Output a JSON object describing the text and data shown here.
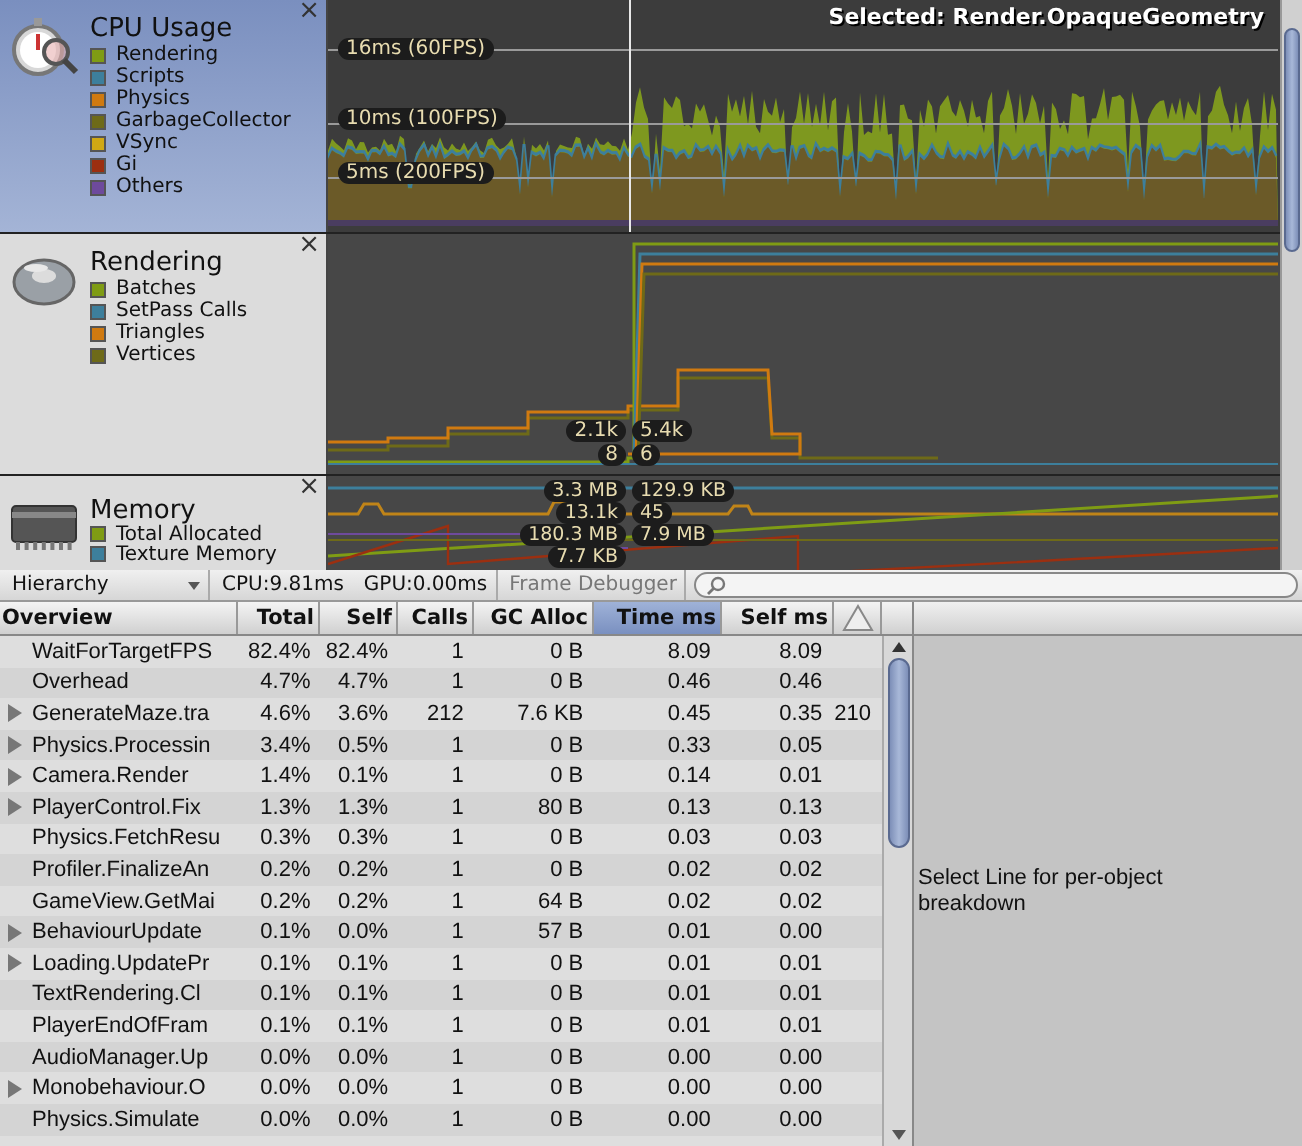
{
  "modules": [
    {
      "kind": "cpu",
      "title": "CPU Usage",
      "selected": true,
      "legend": [
        {
          "label": "Rendering",
          "color": "#7f9c14"
        },
        {
          "label": "Scripts",
          "color": "#3d7f9c"
        },
        {
          "label": "Physics",
          "color": "#d07a10"
        },
        {
          "label": "GarbageCollector",
          "color": "#6e6a18"
        },
        {
          "label": "VSync",
          "color": "#d0a814"
        },
        {
          "label": "Gi",
          "color": "#9c2f10"
        },
        {
          "label": "Others",
          "color": "#6e4a9c"
        }
      ],
      "grid_labels": [
        "16ms (60FPS)",
        "10ms (100FPS)",
        "5ms (200FPS)"
      ],
      "selected_label": "Selected: Render.OpaqueGeometry"
    },
    {
      "kind": "rendering",
      "title": "Rendering",
      "selected": false,
      "legend": [
        {
          "label": "Batches",
          "color": "#7f9c14"
        },
        {
          "label": "SetPass Calls",
          "color": "#3d7f9c"
        },
        {
          "label": "Triangles",
          "color": "#d07a10"
        },
        {
          "label": "Vertices",
          "color": "#6e6a18"
        }
      ],
      "left_labels": [
        {
          "text": "2.1k"
        },
        {
          "text": "8"
        }
      ],
      "right_labels": [
        {
          "text": "5.4k"
        },
        {
          "text": "6"
        }
      ]
    },
    {
      "kind": "memory",
      "title": "Memory",
      "selected": false,
      "legend": [
        {
          "label": "Total Allocated",
          "color": "#7f9c14"
        },
        {
          "label": "Texture Memory",
          "color": "#3d7f9c"
        }
      ],
      "left_labels": [
        {
          "text": "3.3 MB"
        },
        {
          "text": "13.1k"
        },
        {
          "text": "180.3 MB"
        },
        {
          "text": "7.7 KB"
        }
      ],
      "right_labels": [
        {
          "text": "129.9 KB"
        },
        {
          "text": "45"
        },
        {
          "text": "7.9 MB"
        }
      ]
    }
  ],
  "close_glyph": "×",
  "toolbar": {
    "view": "Hierarchy",
    "cpu": "CPU:9.81ms",
    "gpu": "GPU:0.00ms",
    "frame_debugger": "Frame Debugger"
  },
  "table": {
    "columns": [
      {
        "label": "Overview",
        "selected": false
      },
      {
        "label": "Total",
        "selected": false
      },
      {
        "label": "Self",
        "selected": false
      },
      {
        "label": "Calls",
        "selected": false
      },
      {
        "label": "GC Alloc",
        "selected": false
      },
      {
        "label": "Time ms",
        "selected": true
      },
      {
        "label": "Self ms",
        "selected": false
      }
    ],
    "rows": [
      {
        "expandable": false,
        "cells": [
          "WaitForTargetFPS",
          "82.4%",
          "82.4%",
          "1",
          "0 B",
          "8.09",
          "8.09"
        ]
      },
      {
        "expandable": false,
        "cells": [
          "Overhead",
          "4.7%",
          "4.7%",
          "1",
          "0 B",
          "0.46",
          "0.46"
        ]
      },
      {
        "expandable": true,
        "cells": [
          "GenerateMaze.tra",
          "4.6%",
          "3.6%",
          "212",
          "7.6 KB",
          "0.45",
          "0.35"
        ],
        "warnings": "210"
      },
      {
        "expandable": true,
        "cells": [
          "Physics.Processin",
          "3.4%",
          "0.5%",
          "1",
          "0 B",
          "0.33",
          "0.05"
        ]
      },
      {
        "expandable": true,
        "cells": [
          "Camera.Render",
          "1.4%",
          "0.1%",
          "1",
          "0 B",
          "0.14",
          "0.01"
        ]
      },
      {
        "expandable": true,
        "cells": [
          "PlayerControl.Fix",
          "1.3%",
          "1.3%",
          "1",
          "80 B",
          "0.13",
          "0.13"
        ]
      },
      {
        "expandable": false,
        "cells": [
          "Physics.FetchResu",
          "0.3%",
          "0.3%",
          "1",
          "0 B",
          "0.03",
          "0.03"
        ]
      },
      {
        "expandable": false,
        "cells": [
          "Profiler.FinalizeAn",
          "0.2%",
          "0.2%",
          "1",
          "0 B",
          "0.02",
          "0.02"
        ]
      },
      {
        "expandable": false,
        "cells": [
          "GameView.GetMai",
          "0.2%",
          "0.2%",
          "1",
          "64 B",
          "0.02",
          "0.02"
        ]
      },
      {
        "expandable": true,
        "cells": [
          "BehaviourUpdate",
          "0.1%",
          "0.0%",
          "1",
          "57 B",
          "0.01",
          "0.00"
        ]
      },
      {
        "expandable": true,
        "cells": [
          "Loading.UpdatePr",
          "0.1%",
          "0.1%",
          "1",
          "0 B",
          "0.01",
          "0.01"
        ]
      },
      {
        "expandable": false,
        "cells": [
          "TextRendering.Cl",
          "0.1%",
          "0.1%",
          "1",
          "0 B",
          "0.01",
          "0.01"
        ]
      },
      {
        "expandable": false,
        "cells": [
          "PlayerEndOfFram",
          "0.1%",
          "0.1%",
          "1",
          "0 B",
          "0.01",
          "0.01"
        ]
      },
      {
        "expandable": false,
        "cells": [
          "AudioManager.Up",
          "0.0%",
          "0.0%",
          "1",
          "0 B",
          "0.00",
          "0.00"
        ]
      },
      {
        "expandable": true,
        "cells": [
          "Monobehaviour.O",
          "0.0%",
          "0.0%",
          "1",
          "0 B",
          "0.00",
          "0.00"
        ]
      },
      {
        "expandable": false,
        "cells": [
          "Physics.Simulate",
          "0.0%",
          "0.0%",
          "1",
          "0 B",
          "0.00",
          "0.00"
        ]
      }
    ]
  },
  "detail": {
    "message": "Select Line for per-object breakdown"
  }
}
